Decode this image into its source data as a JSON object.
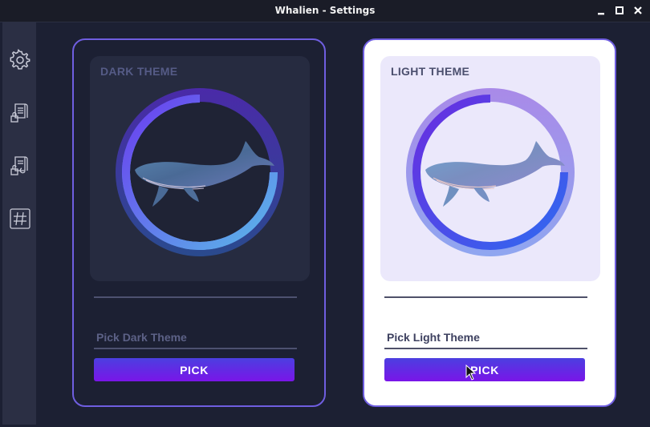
{
  "window": {
    "title": "Whalien - Settings",
    "controls": [
      "minimize-icon",
      "maximize-icon",
      "close-icon"
    ]
  },
  "sidebar": {
    "items": [
      {
        "name": "settings",
        "icon": "gear-icon"
      },
      {
        "name": "encrypt-document",
        "icon": "locked-document-icon"
      },
      {
        "name": "decrypt-document",
        "icon": "unlocked-document-icon"
      },
      {
        "name": "hash",
        "icon": "hash-icon"
      }
    ]
  },
  "themes": {
    "dark": {
      "preview_label": "DARK THEME",
      "input_placeholder": "Pick Dark Theme",
      "input_value": "",
      "button_label": "PICK",
      "colors": {
        "card_bg": "#1c2033",
        "preview_bg": "#262b40",
        "ring_start": "#5a3cf0",
        "ring_end": "#4db6e8"
      }
    },
    "light": {
      "preview_label": "LIGHT THEME",
      "input_placeholder": "Pick Light Theme",
      "input_value": "",
      "button_label": "PICK",
      "colors": {
        "card_bg": "#ffffff",
        "preview_bg": "#ebe8fb",
        "ring_start": "#6a2ce0",
        "ring_end": "#2f6af0"
      }
    }
  },
  "colors": {
    "accent": "#6f5ee0",
    "button_gradient_top": "#4b3fe0",
    "button_gradient_bottom": "#7a15e8",
    "app_bg": "#1c2033",
    "sidebar_bg": "#2b2f44"
  }
}
